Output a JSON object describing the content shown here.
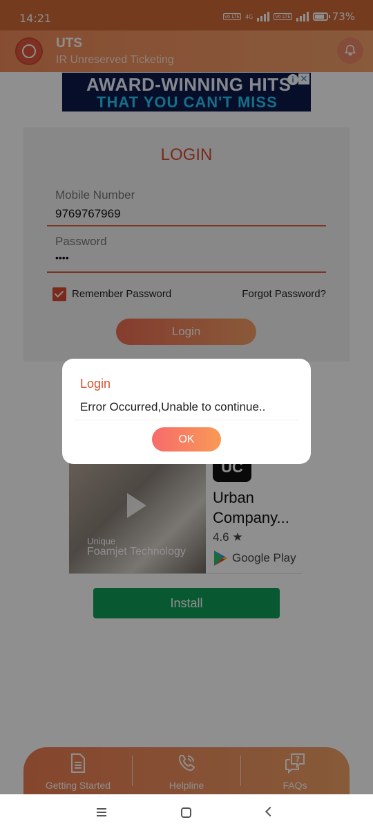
{
  "status_bar": {
    "time": "14:21",
    "network_tag_1": "Vo LTE",
    "network_type": "4G",
    "network_tag_2": "Vo LTE",
    "battery": "73%"
  },
  "app_header": {
    "title": "UTS",
    "subtitle": "IR Unreserved Ticketing",
    "logo_icon": "indian-railways-logo",
    "bell_icon": "bell-icon"
  },
  "ad_banner": {
    "line1": "AWARD-WINNING HITS",
    "line2": "THAT YOU CAN'T MISS",
    "info_icon": "i",
    "close_icon": "✕"
  },
  "login_form": {
    "title": "LOGIN",
    "mobile_label": "Mobile Number",
    "mobile_value": "9769767969",
    "password_label": "Password",
    "password_value": "••••",
    "remember_label": "Remember Password",
    "remember_checked": true,
    "forgot_label": "Forgot Password?",
    "login_button": "Login"
  },
  "app_ad": {
    "video_line1": "Unique",
    "video_line2": "Foamjet Technology",
    "app_icon_text": "UC",
    "app_name": "Urban Company...",
    "rating": "4.6 ★",
    "store_label": "Google Play",
    "install_button": "Install"
  },
  "bottom_nav": {
    "items": [
      {
        "label": "Getting Started",
        "icon": "document-icon"
      },
      {
        "label": "Helpline",
        "icon": "phone-icon"
      },
      {
        "label": "FAQs",
        "icon": "faq-icon"
      }
    ]
  },
  "dialog": {
    "title": "Login",
    "message": "Error Occurred,Unable to continue..",
    "ok_button": "OK"
  },
  "colors": {
    "primary": "#e0663c",
    "accent_red": "#d94a30",
    "install_green": "#0f9d58"
  }
}
